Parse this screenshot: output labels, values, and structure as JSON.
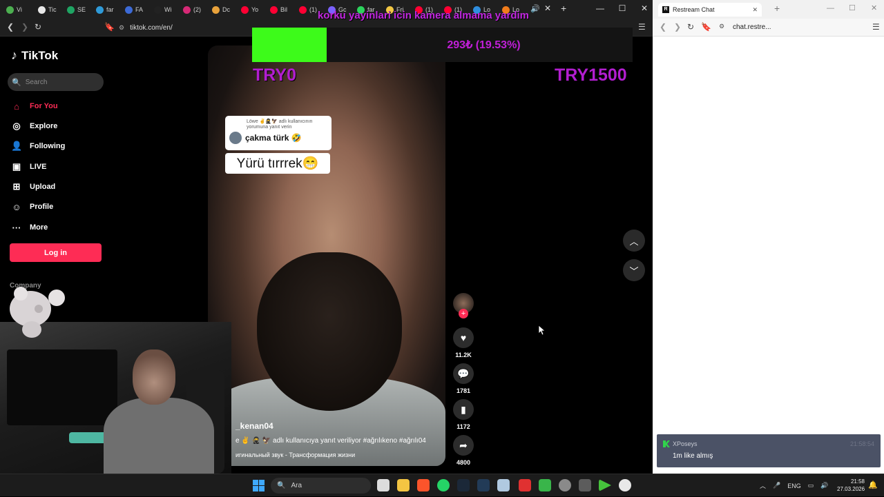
{
  "left_browser": {
    "tabs": [
      {
        "label": "Vi",
        "color": "#4caf50"
      },
      {
        "label": "Tic",
        "color": "#e8e8e8"
      },
      {
        "label": "SE",
        "color": "#1fa463"
      },
      {
        "label": "far",
        "color": "#2f9ad8"
      },
      {
        "label": "FA",
        "color": "#3c6ad6"
      },
      {
        "label": "Wi",
        "color": "#222"
      },
      {
        "label": "(2)",
        "color": "#d62976"
      },
      {
        "label": "Dc",
        "color": "#e8a23b"
      },
      {
        "label": "Yo",
        "color": "#ff0033"
      },
      {
        "label": "Bil",
        "color": "#ff0033"
      },
      {
        "label": "(1)",
        "color": "#ff0033"
      },
      {
        "label": "Gc",
        "color": "#7b61ff"
      },
      {
        "label": "far",
        "color": "#2cd35c"
      },
      {
        "label": "Fri",
        "color": "#f2c744"
      },
      {
        "label": "(1)",
        "color": "#ff0033"
      },
      {
        "label": "(1)",
        "color": "#ff0033"
      },
      {
        "label": "Lo",
        "color": "#2f8ede"
      },
      {
        "label": "Lo",
        "color": "#f07c1b"
      }
    ],
    "url": "tiktok.com/en/"
  },
  "tiktok": {
    "logo_text": "TikTok",
    "search_placeholder": "Search",
    "nav": [
      {
        "label": "For You",
        "icon": "home-icon"
      },
      {
        "label": "Explore",
        "icon": "compass-icon"
      },
      {
        "label": "Following",
        "icon": "following-icon"
      },
      {
        "label": "LIVE",
        "icon": "live-icon"
      },
      {
        "label": "Upload",
        "icon": "upload-icon"
      },
      {
        "label": "Profile",
        "icon": "profile-icon"
      },
      {
        "label": "More",
        "icon": "more-icon"
      }
    ],
    "login_label": "Log in",
    "company_label": "Company",
    "video": {
      "reply_meta": "Löwe ✌️🥷🦅 adlı kullanıcının yorumuna yanıt verin",
      "reply_comment": "çakma türk 🤣",
      "reply_text": "Yürü tırrrek😁",
      "username": "_kenan04",
      "description": "e ✌️ 🥷 🦅 adlı kullanıcıya yanıt veriliyor #ağrılıkeno #ağrılı04",
      "sound": "игинальный звук - Трансформация жизни"
    },
    "actions": {
      "likes": "11.2K",
      "comments": "1781",
      "saves": "1172",
      "shares": "4800"
    }
  },
  "overlay": {
    "stream_title": "korku yayinlari icin kamera almama yardim",
    "donation_amount": "293₺ (19.53%)",
    "donation_progress": 0.1953,
    "donation_min": "TRY0",
    "donation_max": "TRY1500",
    "fill_color": "#3dfb1a",
    "text_color": "#c11fd8"
  },
  "right_browser": {
    "tab_label": "Restream Chat",
    "url": "chat.restre...",
    "chat": {
      "user": "XPoseys",
      "time": "21:58:54",
      "message": "1m like almış"
    }
  },
  "taskbar": {
    "search_placeholder": "Ara",
    "language": "ENG",
    "time": "21:58",
    "date": "27.03.2026"
  }
}
